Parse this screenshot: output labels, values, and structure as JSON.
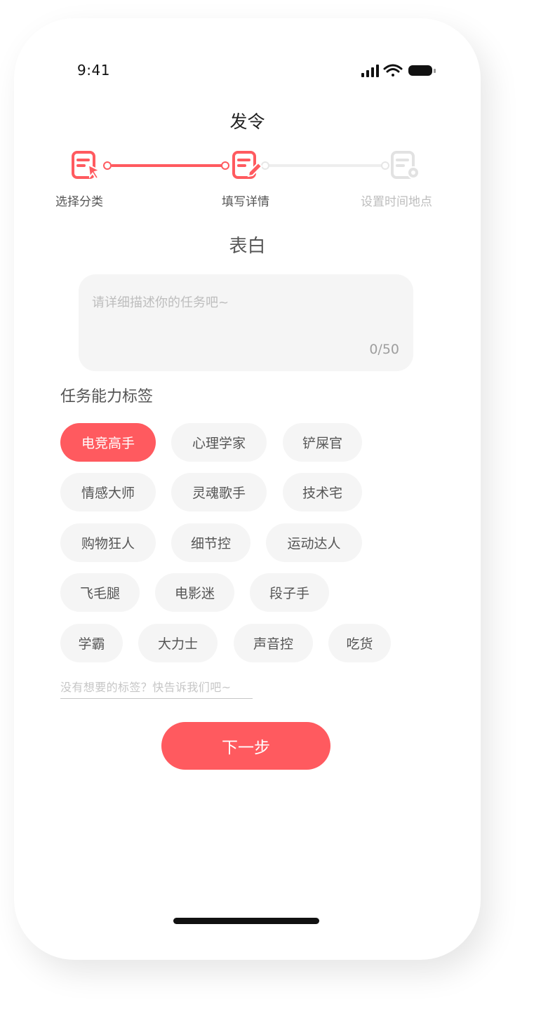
{
  "status": {
    "time": "9:41"
  },
  "nav": {
    "title": "发令"
  },
  "steps": [
    {
      "label": "选择分类",
      "state": "done",
      "icon": "task-cursor-icon"
    },
    {
      "label": "填写详情",
      "state": "active",
      "icon": "task-edit-icon"
    },
    {
      "label": "设置时间地点",
      "state": "pending",
      "icon": "task-settings-icon"
    }
  ],
  "category": {
    "title": "表白"
  },
  "description": {
    "placeholder": "请详细描述你的任务吧~",
    "count": "0/50"
  },
  "tags": {
    "title": "任务能力标签",
    "items": [
      {
        "label": "电竞高手",
        "selected": true
      },
      {
        "label": "心理学家",
        "selected": false
      },
      {
        "label": "铲屎官",
        "selected": false
      },
      {
        "label": "情感大师",
        "selected": false
      },
      {
        "label": "灵魂歌手",
        "selected": false
      },
      {
        "label": "技术宅",
        "selected": false
      },
      {
        "label": "购物狂人",
        "selected": false
      },
      {
        "label": "细节控",
        "selected": false
      },
      {
        "label": "运动达人",
        "selected": false
      },
      {
        "label": "飞毛腿",
        "selected": false
      },
      {
        "label": "电影迷",
        "selected": false
      },
      {
        "label": "段子手",
        "selected": false
      },
      {
        "label": "学霸",
        "selected": false
      },
      {
        "label": "大力士",
        "selected": false
      },
      {
        "label": "声音控",
        "selected": false
      },
      {
        "label": "吃货",
        "selected": false
      }
    ],
    "hint": "没有想要的标签？快告诉我们吧~"
  },
  "actions": {
    "next_label": "下一步"
  },
  "colors": {
    "accent": "#ff5a5f",
    "inactive": "#e0e0e0",
    "chip_bg": "#f5f5f5"
  }
}
